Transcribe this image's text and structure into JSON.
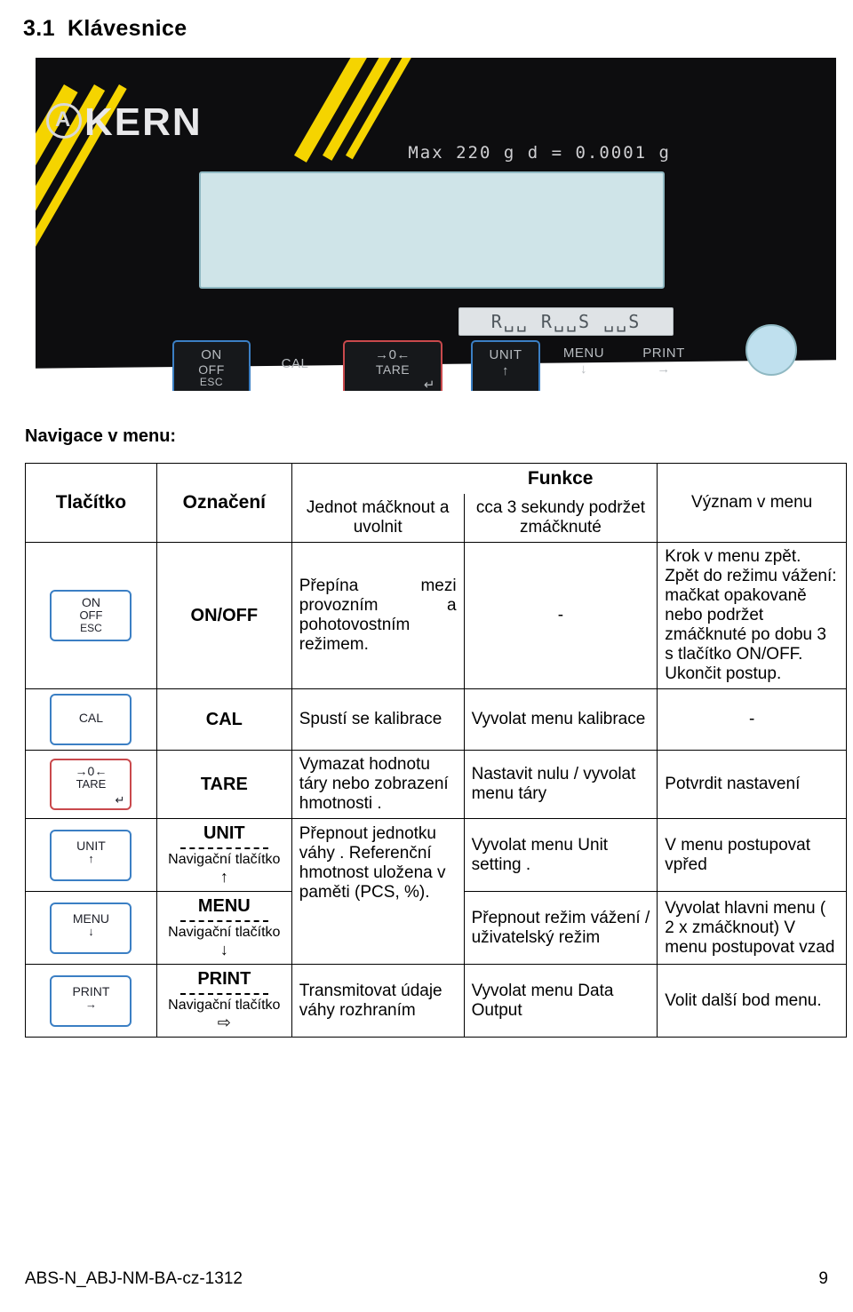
{
  "heading": {
    "number": "3.1",
    "text": "Klávesnice"
  },
  "photo": {
    "brand": "KERN",
    "max_label": "Max  220 g   d = 0.0001 g",
    "segment_display": "R␣␣   R␣␣S   ␣␣S",
    "buttons": [
      {
        "name": "on-off-esc-key",
        "l1": "ON",
        "l2": "OFF",
        "l3": "ESC"
      },
      {
        "name": "cal-key",
        "l1": "CAL",
        "l2": "",
        "l3": ""
      },
      {
        "name": "tare-key",
        "l1": "→0←",
        "l2": "TARE",
        "l3": "↵"
      },
      {
        "name": "unit-key",
        "l1": "UNIT",
        "l2": "↑",
        "l3": ""
      },
      {
        "name": "menu-key",
        "l1": "MENU",
        "l2": "↓",
        "l3": ""
      },
      {
        "name": "print-key",
        "l1": "PRINT",
        "l2": "→",
        "l3": ""
      }
    ]
  },
  "nav_title": "Navigace v menu:",
  "table": {
    "headers": {
      "key": "Tlačítko",
      "denotation": "Označení",
      "press_once": "Jednot máčknout a uvolnit",
      "funkce": "Funkce",
      "hold": "cca  3 sekundy podržet zmáčknuté",
      "meaning": "Význam v menu"
    },
    "rows": [
      {
        "icon": {
          "name": "on-off-esc-key-icon",
          "l1": "ON",
          "l2": "OFF",
          "l3": "ESC",
          "color": "blue"
        },
        "denotation": "ON/OFF",
        "press_once": "Přepína mezi provozním a pohotovostním režimem.",
        "hold": "-",
        "meaning": "Krok v menu zpět. Zpět do režimu vážení: mačkat opakovaně nebo podržet zmáčknuté po dobu 3 s tlačítko ON/OFF. Ukončit postup."
      },
      {
        "icon": {
          "name": "cal-key-icon",
          "l1": "CAL",
          "l2": "",
          "l3": "",
          "color": "blue"
        },
        "denotation": "CAL",
        "press_once": "Spustí se kalibrace",
        "hold": "Vyvolat  menu kalibrace",
        "meaning": "-"
      },
      {
        "icon": {
          "name": "tare-key-icon",
          "l1": "→0←",
          "l2": "TARE",
          "l3": "↵",
          "color": "red"
        },
        "denotation": "TARE",
        "denotation_sub": "",
        "press_once": "Vymazat hodnotu táry nebo zobrazení hmotnosti .",
        "hold": "Nastavit nulu /  vyvolat menu táry",
        "meaning": "Potvrdit nastavení"
      },
      {
        "icon": {
          "name": "unit-key-icon",
          "l1": "UNIT",
          "l2": "↑",
          "l3": "",
          "color": "blue"
        },
        "denotation": "UNIT",
        "denotation_sub": "Navigační tlačítko",
        "denotation_arrow": "↑",
        "press_once": "Přepnout jednotku váhy . Referenční hmotnost uložena v paměti (PCS, %).",
        "hold": "Vyvolat menu Unit setting .",
        "meaning": "V menu postupovat vpřed"
      },
      {
        "icon": {
          "name": "menu-key-icon",
          "l1": "MENU",
          "l2": "↓",
          "l3": "",
          "color": "blue"
        },
        "denotation": "MENU",
        "denotation_sub": "Navigační tlačítko",
        "denotation_arrow": "↓",
        "press_once": "",
        "hold": "Přepnout režim vážení / uživatelský režim",
        "meaning": "Vyvolat hlavni menu ( 2  x zmáčknout) V menu postupovat vzad"
      },
      {
        "icon": {
          "name": "print-key-icon",
          "l1": "PRINT",
          "l2": "→",
          "l3": "",
          "color": "blue"
        },
        "denotation": "PRINT",
        "denotation_sub": "Navigační tlačítko",
        "denotation_arrow": "⇨",
        "press_once": "Transmitovat údaje váhy rozhraním",
        "hold": "Vyvolat menu Data Output",
        "meaning": "Volit další bod menu."
      }
    ]
  },
  "footer": {
    "doc_id": "ABS-N_ABJ-NM-BA-cz-1312",
    "page": "9"
  }
}
